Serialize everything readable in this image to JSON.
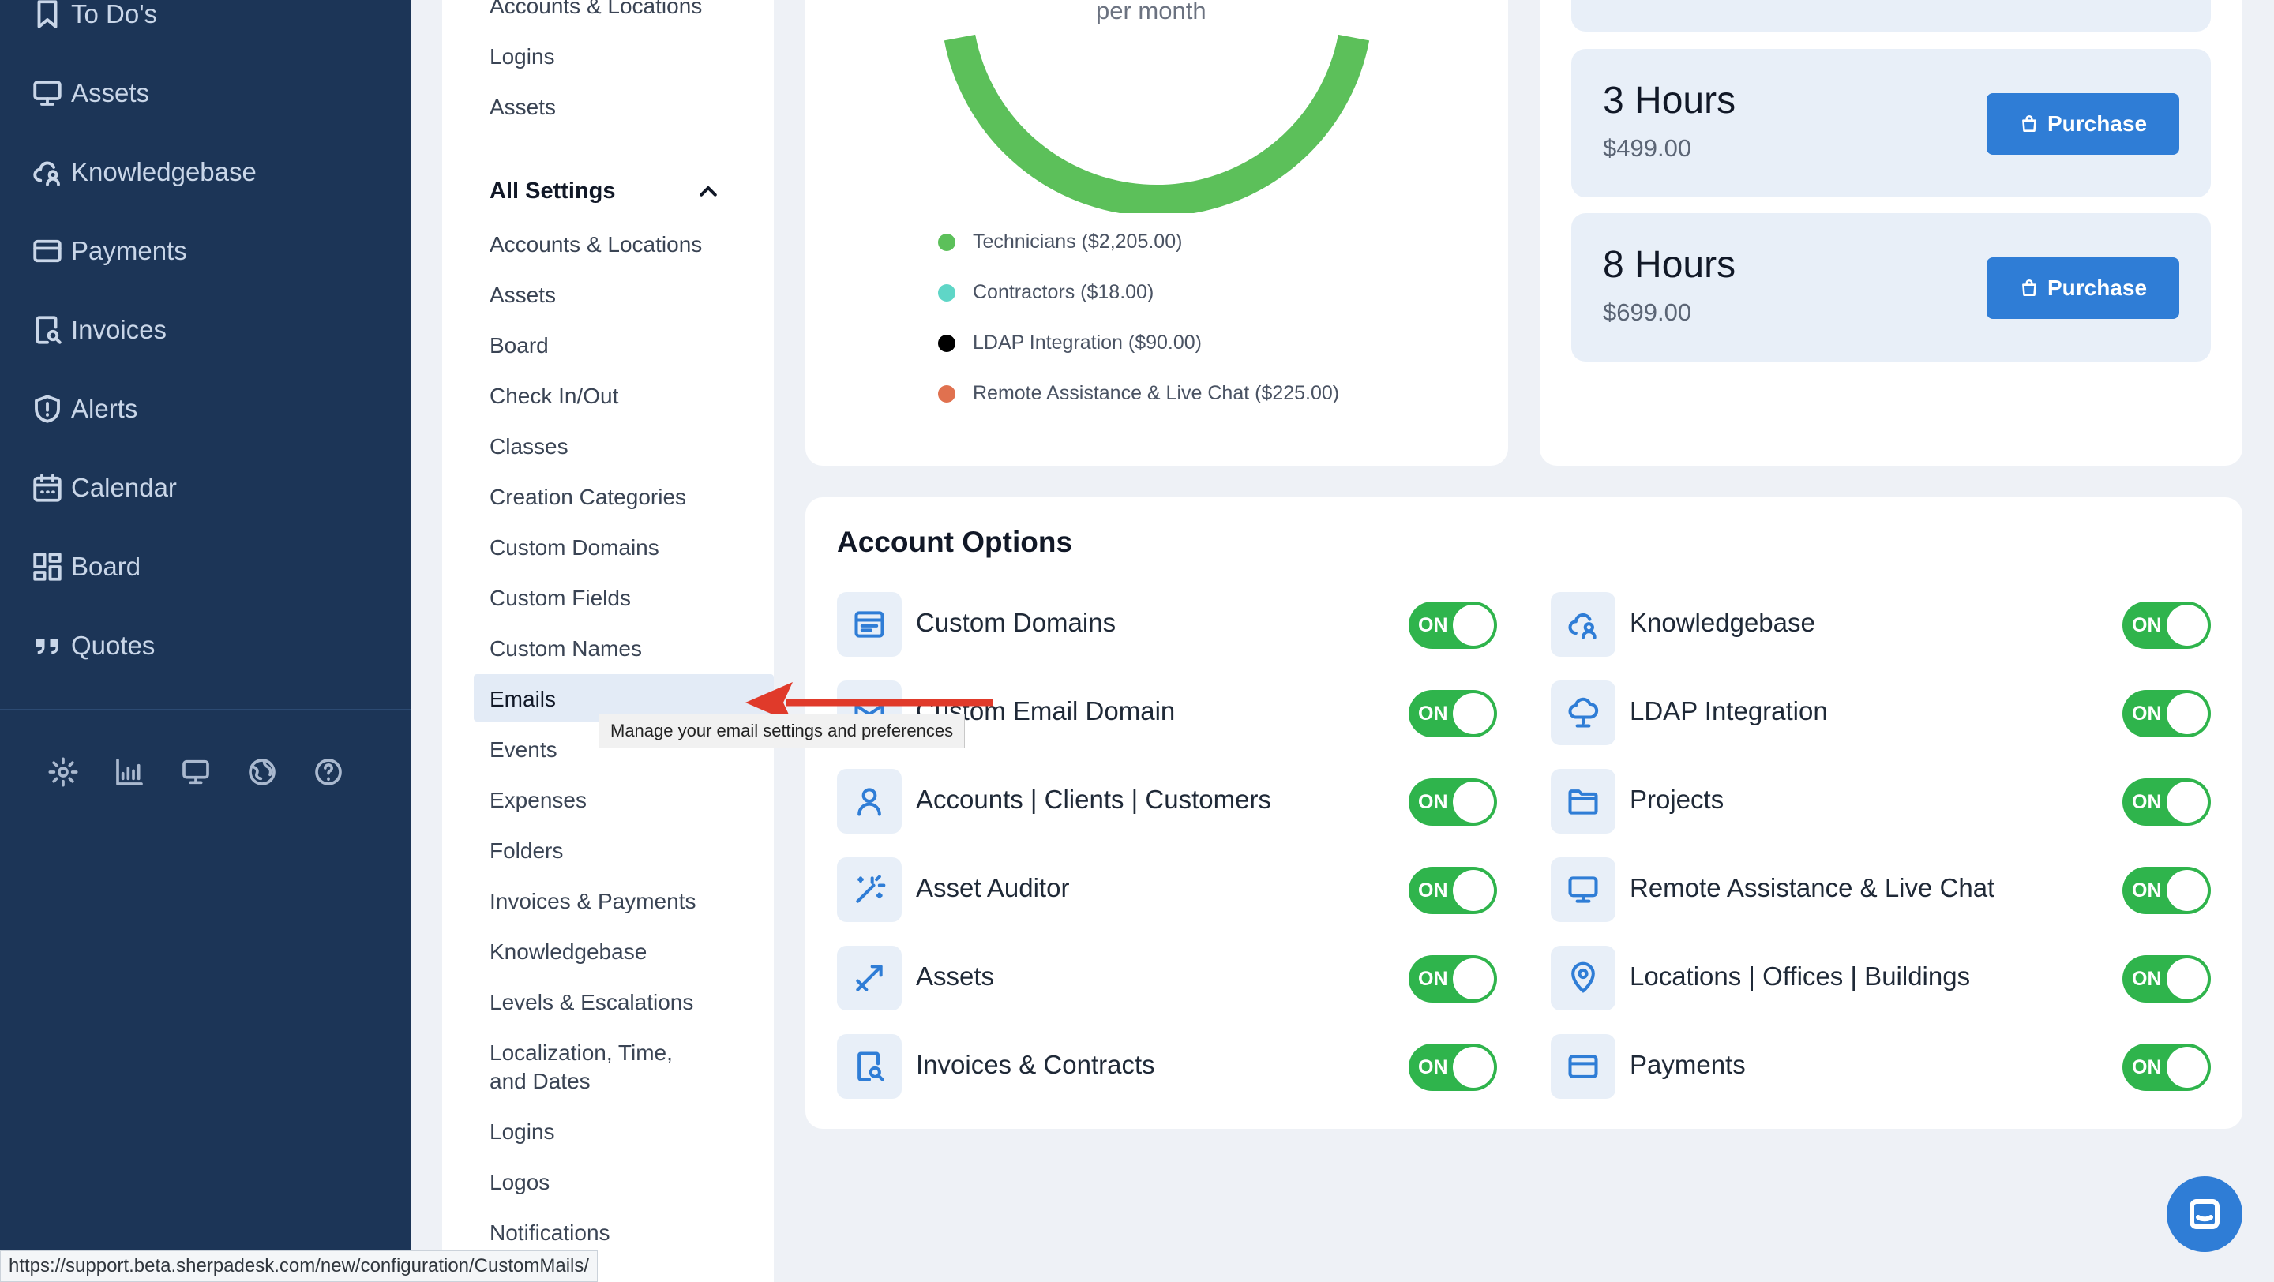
{
  "left_nav": {
    "items": [
      {
        "label": "To Do's",
        "icon": "bookmark-icon"
      },
      {
        "label": "Assets",
        "icon": "monitor-icon"
      },
      {
        "label": "Knowledgebase",
        "icon": "cloud-user-icon"
      },
      {
        "label": "Payments",
        "icon": "credit-card-icon"
      },
      {
        "label": "Invoices",
        "icon": "invoice-search-icon"
      },
      {
        "label": "Alerts",
        "icon": "shield-alert-icon"
      },
      {
        "label": "Calendar",
        "icon": "calendar-icon"
      },
      {
        "label": "Board",
        "icon": "board-icon"
      },
      {
        "label": "Quotes",
        "icon": "quote-icon"
      }
    ],
    "bottom_icons": [
      "settings-icon",
      "stats-icon",
      "monitor-icon",
      "globe-icon",
      "help-icon"
    ]
  },
  "settings_menu": {
    "top_links": [
      "Accounts & Locations",
      "Logins",
      "Assets"
    ],
    "section_title": "All Settings",
    "links": [
      "Accounts & Locations",
      "Assets",
      "Board",
      "Check In/Out",
      "Classes",
      "Creation Categories",
      "Custom Domains",
      "Custom Fields",
      "Custom Names",
      "Emails",
      "Events",
      "Expenses",
      "Folders",
      "Invoices & Payments",
      "Knowledgebase",
      "Levels & Escalations",
      "Localization, Time,",
      "and Dates",
      "Logins",
      "Logos",
      "Notifications"
    ],
    "selected": "Emails",
    "tooltip": "Manage your email settings and preferences"
  },
  "chart": {
    "center_text": "per month",
    "ring_color": "#5cc05a"
  },
  "chart_data": {
    "type": "pie",
    "title": "",
    "legend": [
      {
        "label": "Technicians ($2,205.00)",
        "value": 2205.0,
        "color": "#5cc05a"
      },
      {
        "label": "Contractors ($18.00)",
        "value": 18.0,
        "color": "#5fd6c7"
      },
      {
        "label": "LDAP Integration ($90.00)",
        "value": 90.0,
        "color": "#000000"
      },
      {
        "label": "Remote Assistance & Live Chat ($225.00)",
        "value": 225.0,
        "color": "#e0714f"
      }
    ]
  },
  "hours": [
    {
      "title": "3 Hours",
      "price": "$499.00",
      "button": "Purchase"
    },
    {
      "title": "8 Hours",
      "price": "$699.00",
      "button": "Purchase"
    }
  ],
  "account_options": {
    "title": "Account Options",
    "toggle_text": "ON",
    "left": [
      {
        "label": "Custom Domains",
        "icon": "browser-window-icon"
      },
      {
        "label": "Custom Email Domain",
        "icon": "email-icon"
      },
      {
        "label": "Accounts | Clients | Customers",
        "icon": "user-icon"
      },
      {
        "label": "Asset Auditor",
        "icon": "magic-wand-icon"
      },
      {
        "label": "Assets",
        "icon": "ruler-pen-icon"
      },
      {
        "label": "Invoices & Contracts",
        "icon": "invoice-search-icon"
      }
    ],
    "right": [
      {
        "label": "Knowledgebase",
        "icon": "cloud-user-icon"
      },
      {
        "label": "LDAP Integration",
        "icon": "cloud-network-icon"
      },
      {
        "label": "Projects",
        "icon": "folder-icon"
      },
      {
        "label": "Remote Assistance & Live Chat",
        "icon": "monitor-icon"
      },
      {
        "label": "Locations | Offices | Buildings",
        "icon": "map-pin-icon"
      },
      {
        "label": "Payments",
        "icon": "credit-card-icon"
      }
    ]
  },
  "status_bar": {
    "url": "https://support.beta.sherpadesk.com/new/configuration/CustomMails/"
  },
  "colors": {
    "nav_bg": "#1c3557",
    "accent": "#2f7dd6",
    "toggle_on": "#2fb44c",
    "arrow": "#e03a2a"
  }
}
